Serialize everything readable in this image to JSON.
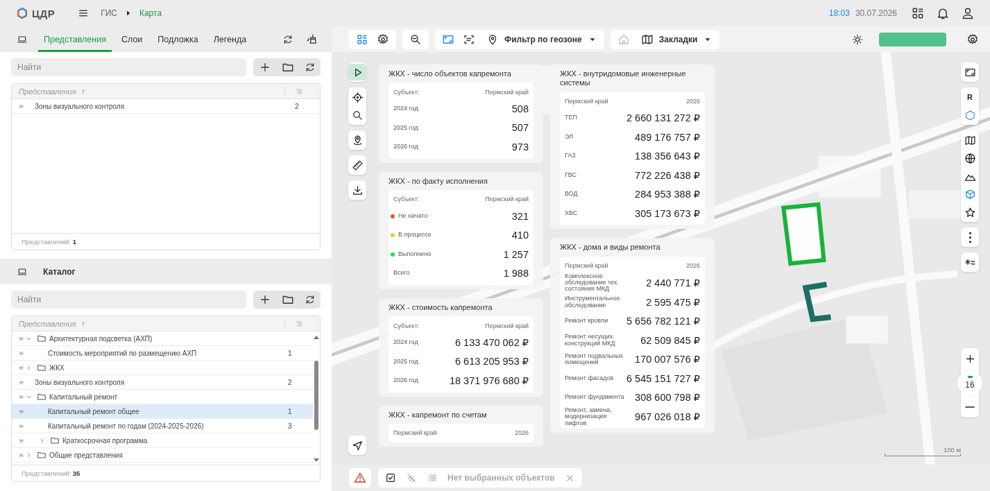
{
  "header": {
    "logo": "ЦДР",
    "breadcrumbs": [
      {
        "label": "ГИС",
        "selected": false
      },
      {
        "label": "Карта",
        "selected": true
      }
    ],
    "time": "18:03",
    "date": "30.07.2026"
  },
  "views_panel": {
    "tabs": [
      {
        "label": "Представления",
        "selected": true
      },
      {
        "label": "Слои",
        "selected": false
      },
      {
        "label": "Подложка",
        "selected": false
      },
      {
        "label": "Легенда",
        "selected": false
      }
    ],
    "search": {
      "placeholder": "Найти"
    },
    "table": {
      "column": "Представления",
      "rows": [
        {
          "kind": "view",
          "label": "Зоны визуального контроля",
          "count": "2",
          "selected": false
        }
      ]
    },
    "footer": {
      "label": "Представлений:",
      "count": "1"
    }
  },
  "catalog_panel": {
    "title": "Каталог",
    "search": {
      "placeholder": "Найти"
    },
    "table": {
      "column": "Представления",
      "rows": [
        {
          "kind": "folder",
          "label": "Архитектурная подсветка (АХП)",
          "expanded": true,
          "selected": false,
          "children": [
            {
              "kind": "view",
              "label": "Стоимость мероприятий по размещению АХП",
              "count": "1",
              "selected": false
            }
          ]
        },
        {
          "kind": "folder",
          "label": "ЖКХ",
          "expanded": false,
          "selected": false
        },
        {
          "kind": "view",
          "label": "Зоны визуального контроля",
          "count": "2",
          "selected": false
        },
        {
          "kind": "folder",
          "label": "Капитальный ремонт",
          "expanded": true,
          "selected": false,
          "children": [
            {
              "kind": "view",
              "label": "Капитальный ремонт общее",
              "count": "1",
              "selected": true
            },
            {
              "kind": "view",
              "label": "Капитальный ремонт по годам (2024-2025-2026)",
              "count": "3",
              "selected": false
            },
            {
              "kind": "folder",
              "label": "Краткосрочная программа",
              "expanded": false,
              "selected": false
            }
          ]
        },
        {
          "kind": "folder",
          "label": "Общие представления",
          "expanded": false,
          "selected": false
        }
      ]
    },
    "footer": {
      "label": "Представлений:",
      "count": "35"
    }
  },
  "map_toolbar": {
    "groups": [
      {
        "items": [
          {
            "kind": "layout",
            "active": true,
            "disabled": false
          },
          {
            "kind": "settings",
            "active": false,
            "disabled": false
          }
        ]
      },
      {
        "items": [
          {
            "kind": "zoom-out",
            "active": false,
            "disabled": false
          }
        ]
      },
      {
        "items": [
          {
            "kind": "fit",
            "active": true,
            "disabled": false
          },
          {
            "kind": "scan",
            "active": false,
            "disabled": false
          },
          {
            "kind": "geozone",
            "label": "Фильтр по геозоне",
            "active": false,
            "disabled": false
          }
        ]
      },
      {
        "items": [
          {
            "kind": "home",
            "active": false,
            "disabled": true
          },
          {
            "kind": "bookmarks",
            "label": "Закладки",
            "active": false,
            "disabled": false
          }
        ]
      }
    ]
  },
  "left_tools": {
    "groups": [
      {
        "tools": [
          {
            "kind": "pointer",
            "active": true
          }
        ]
      },
      {
        "tools": [
          {
            "kind": "locate",
            "active": false
          },
          {
            "kind": "search",
            "active": false
          }
        ]
      },
      {
        "tools": [
          {
            "kind": "place",
            "active": false
          }
        ]
      },
      {
        "tools": [
          {
            "kind": "ruler",
            "active": false
          }
        ]
      },
      {
        "tools": [
          {
            "kind": "download",
            "active": false
          }
        ]
      },
      {
        "tools": [
          {
            "kind": "navigate",
            "active": false
          }
        ]
      }
    ]
  },
  "right_tools": {
    "groups": [
      {
        "tools": [
          {
            "kind": "fullscreen",
            "active": false
          }
        ]
      },
      {
        "tools": [
          {
            "kind": "text",
            "label": "R",
            "active": false
          },
          {
            "kind": "hexagon",
            "active": true
          }
        ]
      },
      {
        "tools": [
          {
            "kind": "map",
            "active": false
          },
          {
            "kind": "globe",
            "active": false
          },
          {
            "kind": "terrain",
            "active": false
          },
          {
            "kind": "cube",
            "active": true
          },
          {
            "kind": "star",
            "active": false
          }
        ]
      },
      {
        "tools": [
          {
            "kind": "more",
            "active": false
          }
        ]
      },
      {
        "tools": [
          {
            "kind": "filter",
            "active": false
          }
        ]
      }
    ]
  },
  "zoom": {
    "level_label": "16"
  },
  "scale": "100 м",
  "card_columns": [
    {
      "cards": [
        {
          "title": "ЖКХ - число объектов капремонта",
          "head": [
            "Субъект:",
            "Пермский край"
          ],
          "rows": [
            {
              "label": "2024 год",
              "value": "508"
            },
            {
              "label": "2025 год",
              "value": "507"
            },
            {
              "label": "2026 год",
              "value": "973"
            }
          ]
        },
        {
          "title": "ЖКХ - по факту исполнения",
          "head": [
            "Субъект:",
            "Пермский край"
          ],
          "rows": [
            {
              "label": "Не начато",
              "value": "321",
              "color": "#f4511e"
            },
            {
              "label": "В процессе",
              "value": "410",
              "color": "#fbc531"
            },
            {
              "label": "Выполнено",
              "value": "1 257",
              "color": "#22dd55"
            },
            {
              "label": "Всего",
              "value": "1 988"
            }
          ]
        },
        {
          "title": "ЖКХ - стоимость капремонта",
          "head": [
            "Субъект:",
            "Пермский край"
          ],
          "rows": [
            {
              "label": "2024 год",
              "value": "6 133 470 062 ₽"
            },
            {
              "label": "2025 год",
              "value": "6 613 205 953 ₽"
            },
            {
              "label": "2026 год",
              "value": "18 371 976 680 ₽"
            }
          ]
        },
        {
          "title": "ЖКХ - капремонт по счетам",
          "head": [
            "Пермский край",
            "2026"
          ]
        }
      ]
    },
    {
      "cards": [
        {
          "title": "ЖКХ - внутридомовые инженерные системы",
          "head": [
            "Пермский край",
            "2026"
          ],
          "rows": [
            {
              "label": "ТЕП",
              "value": "2 660 131 272 ₽"
            },
            {
              "label": "ЭЛ",
              "value": "489 176 757 ₽"
            },
            {
              "label": "ГАЗ",
              "value": "138 356 643 ₽"
            },
            {
              "label": "ГВС",
              "value": "772 226 438 ₽"
            },
            {
              "label": "ВОД",
              "value": "284 953 388 ₽"
            },
            {
              "label": "ХВС",
              "value": "305 173 673 ₽"
            }
          ]
        },
        {
          "title": "ЖКХ - дома и виды ремонта",
          "head": [
            "Пермский край",
            "2026"
          ],
          "rows": [
            {
              "label": "Комплексное обследование тех. состояния МКД",
              "value": "2 440 771 ₽"
            },
            {
              "label": "Инструментальное обследование",
              "value": "2 595 475 ₽"
            },
            {
              "label": "Ремонт кровли",
              "value": "5 656 782 121 ₽"
            },
            {
              "label": "Ремонт несущих конструкций МКД",
              "value": "62 509 845 ₽"
            },
            {
              "label": "Ремонт подвальных помещений",
              "value": "170 007 576 ₽"
            },
            {
              "label": "Ремонт фасадов",
              "value": "6 545 151 727 ₽"
            },
            {
              "label": "Ремонт фундамента",
              "value": "308 600 798 ₽"
            },
            {
              "label": "Ремонт, замена, модернизация лифтов",
              "value": "967 026 018 ₽"
            }
          ]
        }
      ]
    }
  ],
  "selection_bar": {
    "text": "Нет выбранных объектов",
    "disabled": true
  }
}
